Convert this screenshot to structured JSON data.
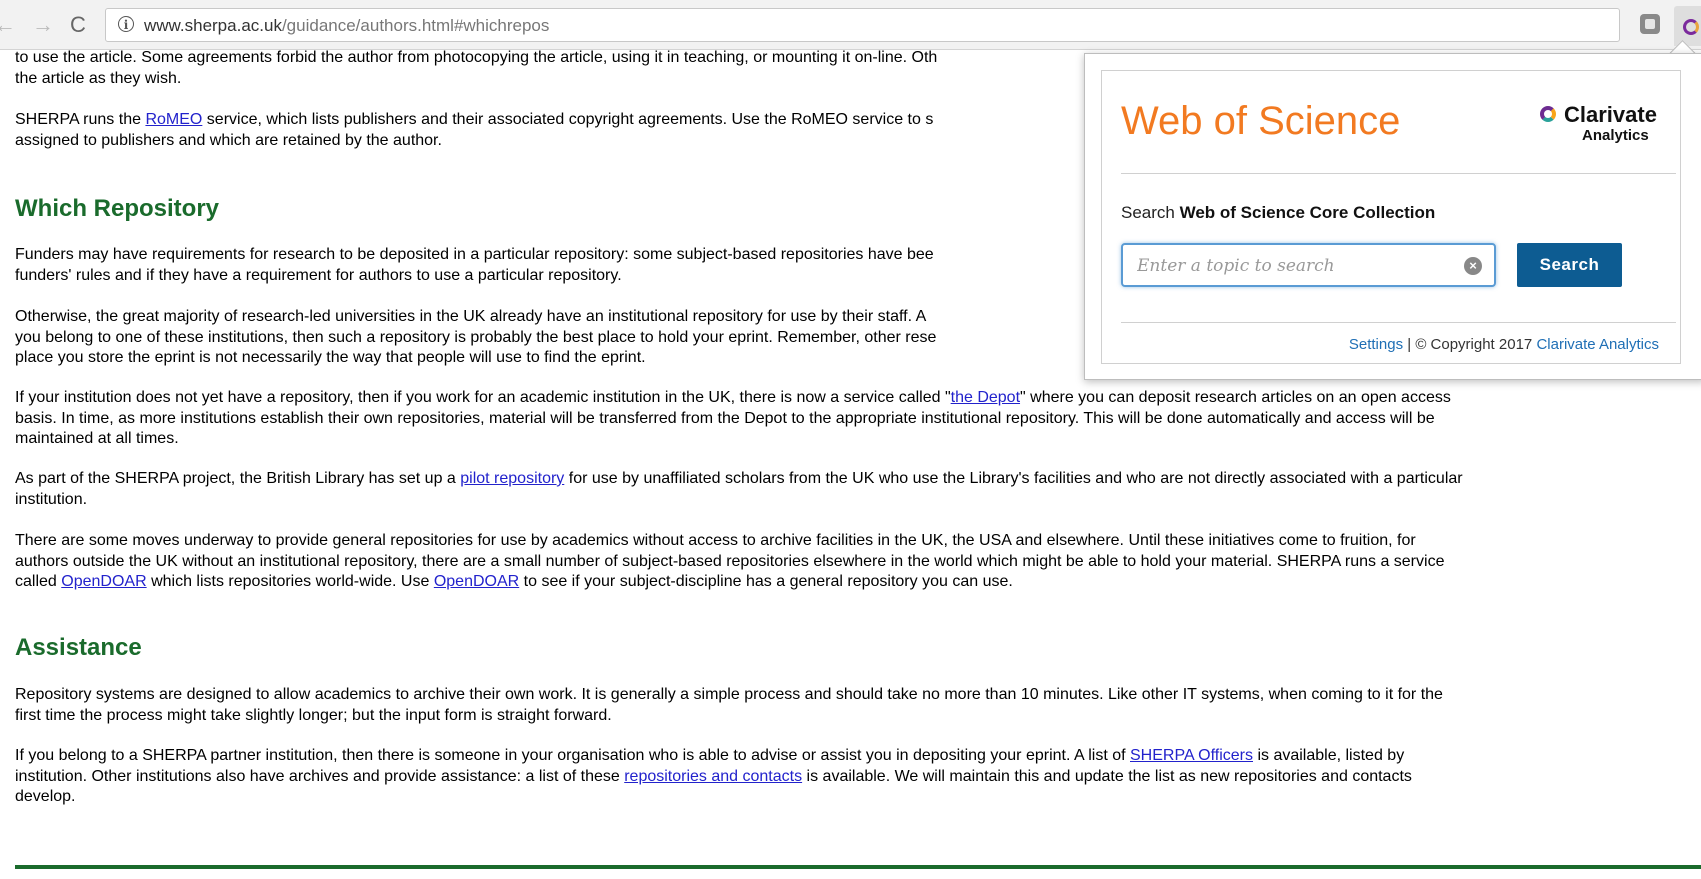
{
  "browser": {
    "url_host": "www.sherpa.ac.uk",
    "url_path": "/guidance/authors.html#whichrepos"
  },
  "page": {
    "intro": {
      "p1_line1": "to use the article. Some agreements forbid the author from photocopying the article, using it in teaching, or mounting it on-line. Oth",
      "p1_line2": "the article as they wish.",
      "p2_a": "SHERPA runs the ",
      "p2_link": "RoMEO",
      "p2_b": " service, which lists publishers and their associated copyright agreements. Use the RoMEO service to s",
      "p2_line2": "assigned to publishers and which are retained by the author."
    },
    "which_repo": {
      "heading": "Which Repository",
      "p1_line1": "Funders may have requirements for research to be deposited in a particular repository: some subject-based repositories have bee",
      "p1_line2": "funders' rules and if they have a requirement for authors to use a particular repository.",
      "p2_line1": "Otherwise, the great majority of research-led universities in the UK already have an institutional repository for use by their staff. A",
      "p2_line2": "you belong to one of these institutions, then such a repository is probably the best place to hold your eprint. Remember, other rese",
      "p2_line3": "place you store the eprint is not necessarily the way that people will use to find the eprint.",
      "p3_a": "If your institution does not yet have a repository, then if you work for an academic institution in the UK, there is now a service called \"",
      "p3_link": "the Depot",
      "p3_b": "\" where you can deposit research articles on an open access",
      "p3_line2": "basis. In time, as more institutions establish their own repositories, material will be transferred from the Depot to the appropriate institutional repository. This will be done automatically and access will be",
      "p3_line3": "maintained at all times.",
      "p4_a": "As part of the SHERPA project, the British Library has set up a ",
      "p4_link": "pilot repository",
      "p4_b": " for use by unaffiliated scholars from the UK who use the Library's facilities and who are not directly associated with a particular",
      "p4_line2": "institution.",
      "p5_line1": "There are some moves underway to provide general repositories for use by academics without access to archive facilities in the UK, the USA and elsewhere. Until these initiatives come to fruition, for",
      "p5_line2": "authors outside the UK without an institutional repository, there are a small number of subject-based repositories elsewhere in the world which might be able to hold your material. SHERPA runs a service",
      "p5_line3_a": "called ",
      "p5_link1": "OpenDOAR",
      "p5_line3_b": " which lists repositories world-wide. Use ",
      "p5_link2": "OpenDOAR",
      "p5_line3_c": " to see if your subject-discipline has a general repository you can use."
    },
    "assistance": {
      "heading": "Assistance",
      "p1_line1": "Repository systems are designed to allow academics to archive their own work. It is generally a simple process and should take no more than 10 minutes. Like other IT systems, when coming to it for the",
      "p1_line2": "first time the process might take slightly longer; but the input form is straight forward.",
      "p2_a": "If you belong to a SHERPA partner institution, then there is someone in your organisation who is able to advise or assist you in depositing your eprint. A list of ",
      "p2_link1": "SHERPA Officers",
      "p2_b": " is available, listed by",
      "p2_line2_a": "institution. Other institutions also have archives and provide assistance: a list of these ",
      "p2_link2": "repositories and contacts",
      "p2_line2_b": " is available. We will maintain this and update the list as new repositories and contacts",
      "p2_line3": "develop."
    }
  },
  "popup": {
    "title": "Web of Science",
    "brand_name": "Clarivate",
    "brand_sub": "Analytics",
    "search_prefix": "Search ",
    "search_collection": "Web of Science Core Collection",
    "input_placeholder": "Enter a topic to search",
    "search_button": "Search",
    "settings_link": "Settings",
    "separator": " | ",
    "copyright": "© Copyright 2017 ",
    "copyright_link": "Clarivate Analytics"
  },
  "colors": {
    "heading_green": "#1a6b2c",
    "wos_orange": "#f27a21",
    "search_button_blue": "#0d5c92"
  }
}
